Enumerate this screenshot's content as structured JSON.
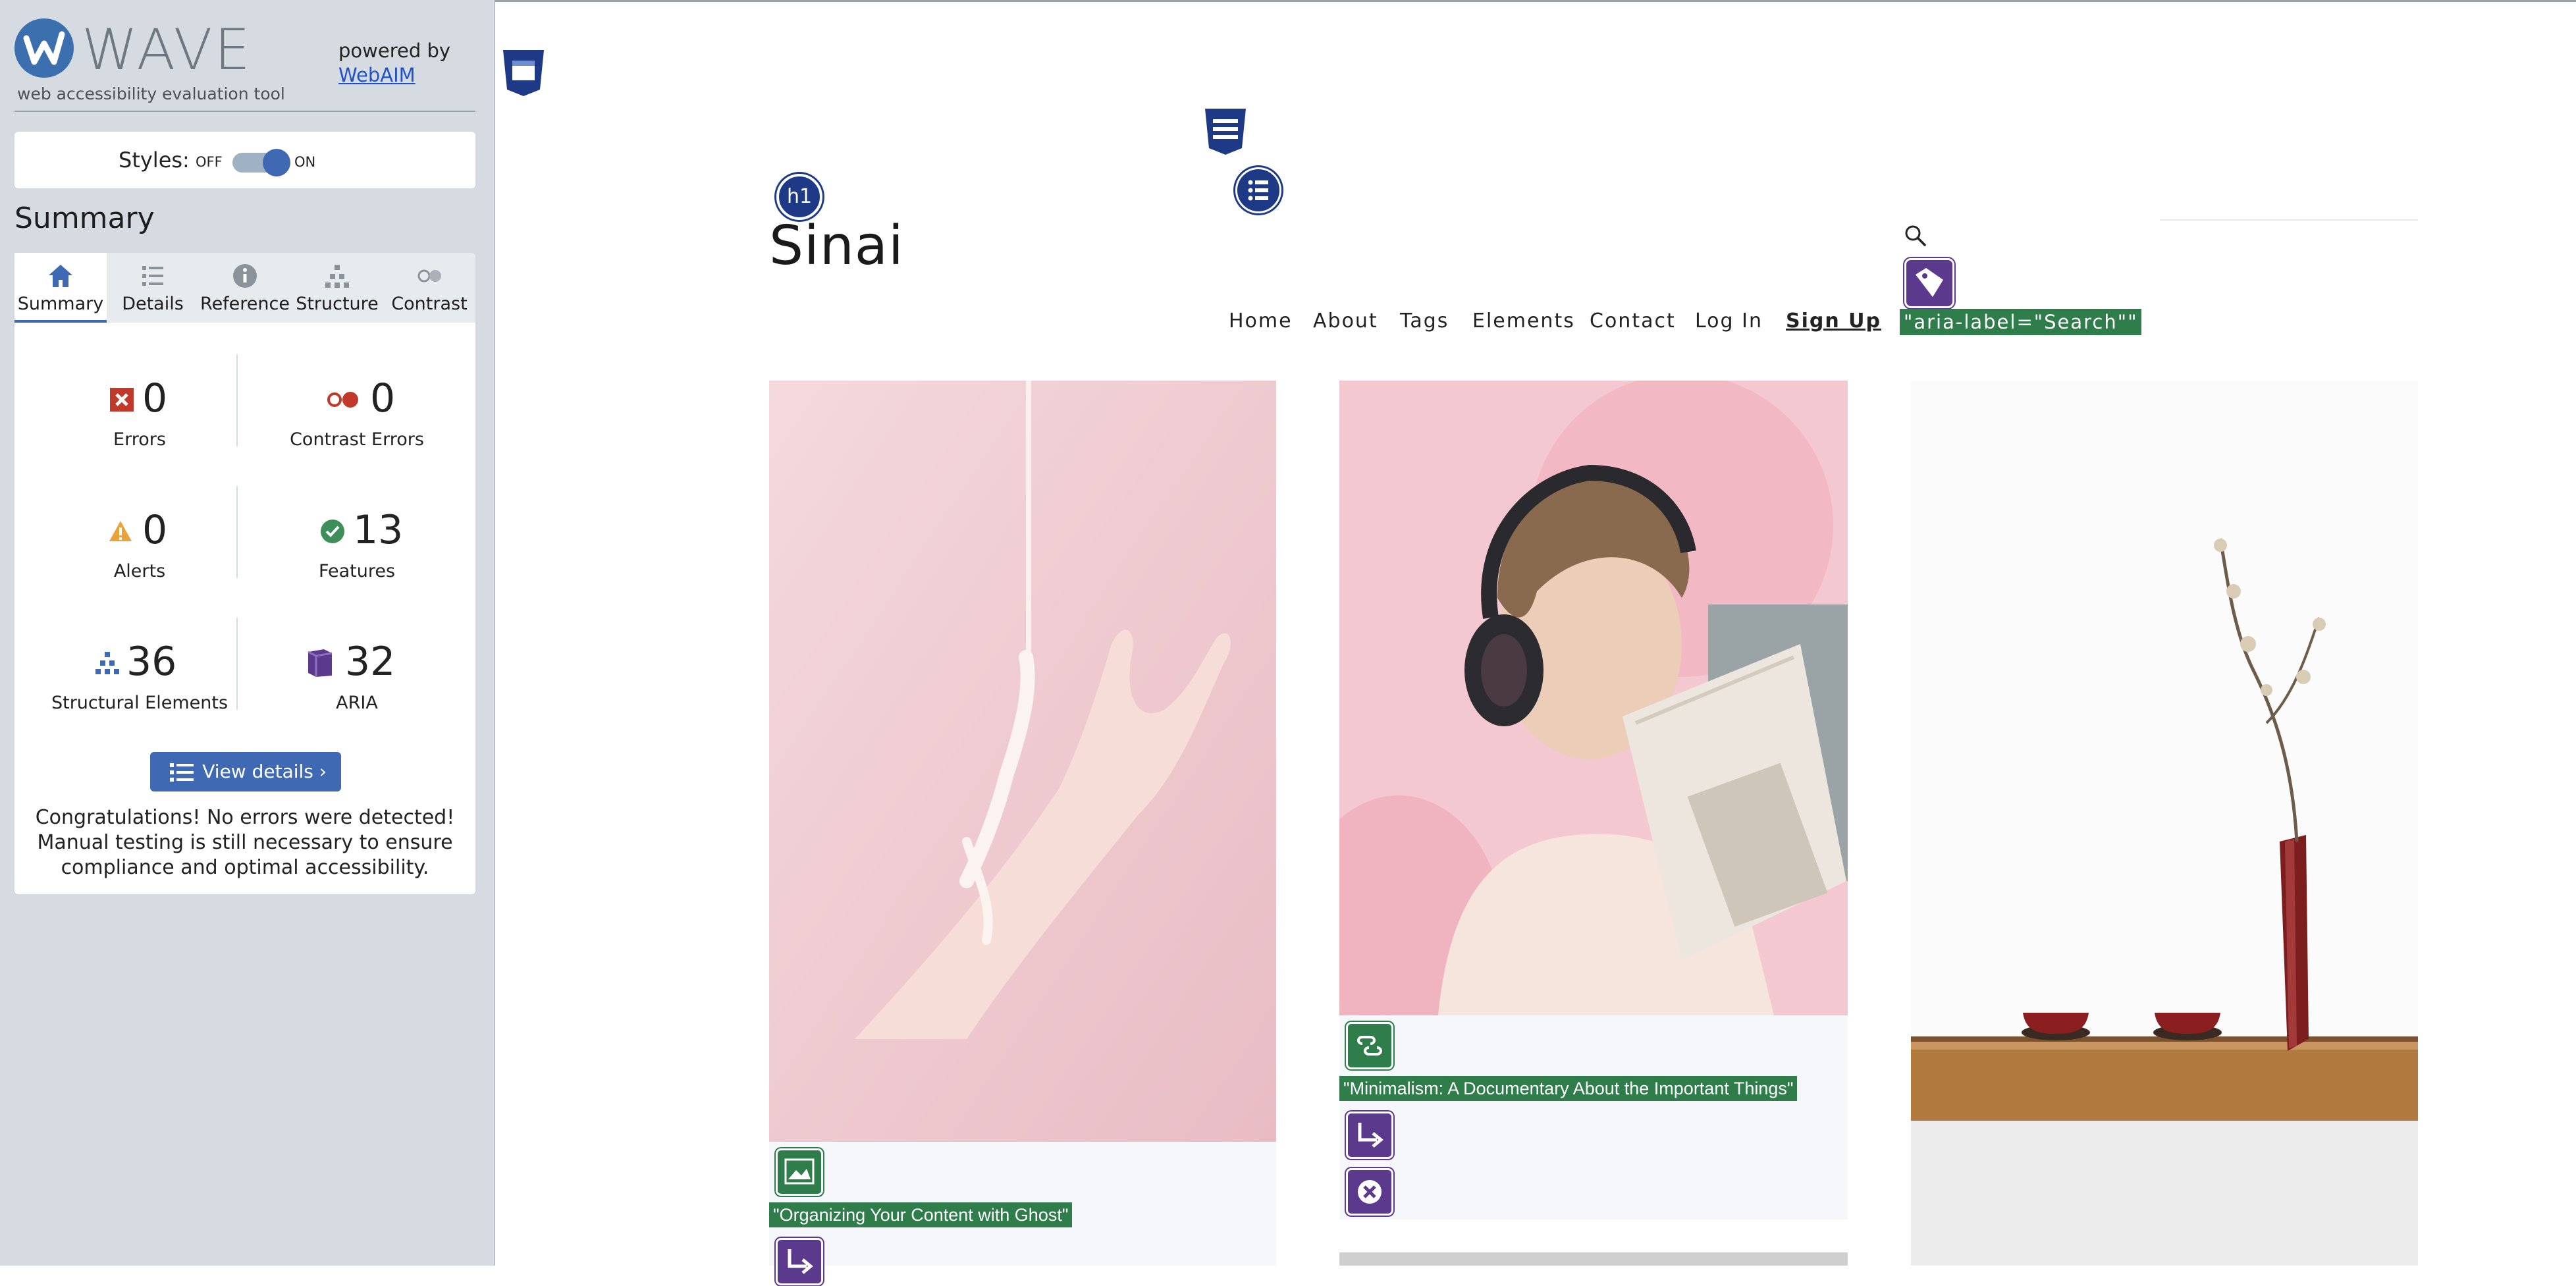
{
  "wave": {
    "brand": "WAVE",
    "tagline": "web accessibility evaluation tool",
    "powered_by": "powered by",
    "webaim_link": "WebAIM",
    "styles_label": "Styles:",
    "styles_off": "OFF",
    "styles_on": "ON",
    "summary_heading": "Summary",
    "tabs": [
      {
        "label": "Summary",
        "icon": "home-icon",
        "active": true
      },
      {
        "label": "Details",
        "icon": "list-icon",
        "active": false
      },
      {
        "label": "Reference",
        "icon": "info-icon",
        "active": false
      },
      {
        "label": "Structure",
        "icon": "hierarchy-icon",
        "active": false
      },
      {
        "label": "Contrast",
        "icon": "contrast-icon",
        "active": false
      }
    ],
    "stats": {
      "errors": {
        "count": "0",
        "label": "Errors",
        "icon": "error-x-icon",
        "color": "#c0392b"
      },
      "contrast_errors": {
        "count": "0",
        "label": "Contrast Errors",
        "icon": "contrast-error-icon",
        "color": "#c0392b"
      },
      "alerts": {
        "count": "0",
        "label": "Alerts",
        "icon": "alert-triangle-icon",
        "color": "#e8a33d"
      },
      "features": {
        "count": "13",
        "label": "Features",
        "icon": "check-circle-icon",
        "color": "#3e8e5a"
      },
      "structural": {
        "count": "36",
        "label": "Structural Elements",
        "icon": "structure-icon",
        "color": "#3f6ab3"
      },
      "aria": {
        "count": "32",
        "label": "ARIA",
        "icon": "aria-cube-icon",
        "color": "#5b3a8e"
      }
    },
    "view_details": "View details ›",
    "congrats": "Congratulations! No errors were detected! Manual testing is still necessary to ensure compliance and optimal accessibility."
  },
  "site": {
    "h1_badge": "h1",
    "title": "Sinai",
    "nav": [
      {
        "label": "Home"
      },
      {
        "label": "About"
      },
      {
        "label": "Tags"
      },
      {
        "label": "Elements"
      },
      {
        "label": "Contact"
      },
      {
        "label": "Log In"
      },
      {
        "label": "Sign Up"
      }
    ],
    "search_aria": "\"aria-label=\"Search\"\"",
    "cards": [
      {
        "title": "\"Organizing Your Content with Ghost\""
      },
      {
        "title": "\"Minimalism: A Documentary About the Important Things\""
      }
    ]
  },
  "colors": {
    "wave_blue": "#3f6ab3",
    "badge_navy": "#1e3a87",
    "feature_green": "#2f7d4b",
    "aria_purple": "#5b3a8e",
    "sidebar_bg": "#d5dbe1"
  }
}
